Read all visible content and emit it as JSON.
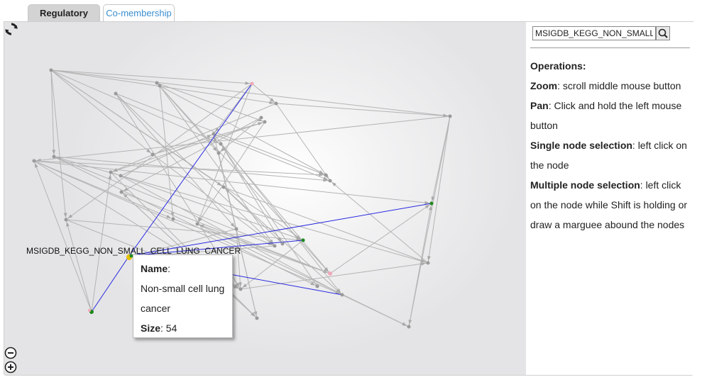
{
  "tabs": [
    {
      "label": "Regulatory",
      "active": true
    },
    {
      "label": "Co-membership",
      "active": false
    }
  ],
  "search": {
    "value": "MSIGDB_KEGG_NON_SMALL_CELL_LUNG_CANCER"
  },
  "operations": {
    "title": "Operations:",
    "items": [
      {
        "term": "Zoom",
        "text": ": scroll middle mouse button"
      },
      {
        "term": "Pan",
        "text": ": Click and hold the left mouse button"
      },
      {
        "term": "Single node selection",
        "text": ": left click on the node"
      },
      {
        "term": "Multiple node selection",
        "text": ": left click on the node while Shift is holding or draw a marguee abound the nodes"
      }
    ]
  },
  "graph": {
    "selected_node_label": "MSIGDB_KEGG_NON_SMALL_CELL_LUNG_CANCER",
    "tooltip": {
      "name_label": "Name",
      "name_value": "Non-small cell lung cancer",
      "size_label": "Size",
      "size_value": "54"
    }
  },
  "colors": {
    "edge": "#b4b4b4",
    "highlight_edge": "#2a2ae0",
    "tab_link": "#3a8fd0",
    "node_green": "#1f8a1f",
    "node_pink": "#f2a8b8",
    "node_yellow": "#e8c000"
  },
  "icons": {
    "refresh": "refresh-icon",
    "zoom_out": "zoom-out-icon",
    "zoom_in": "zoom-in-icon",
    "search": "search-icon"
  }
}
